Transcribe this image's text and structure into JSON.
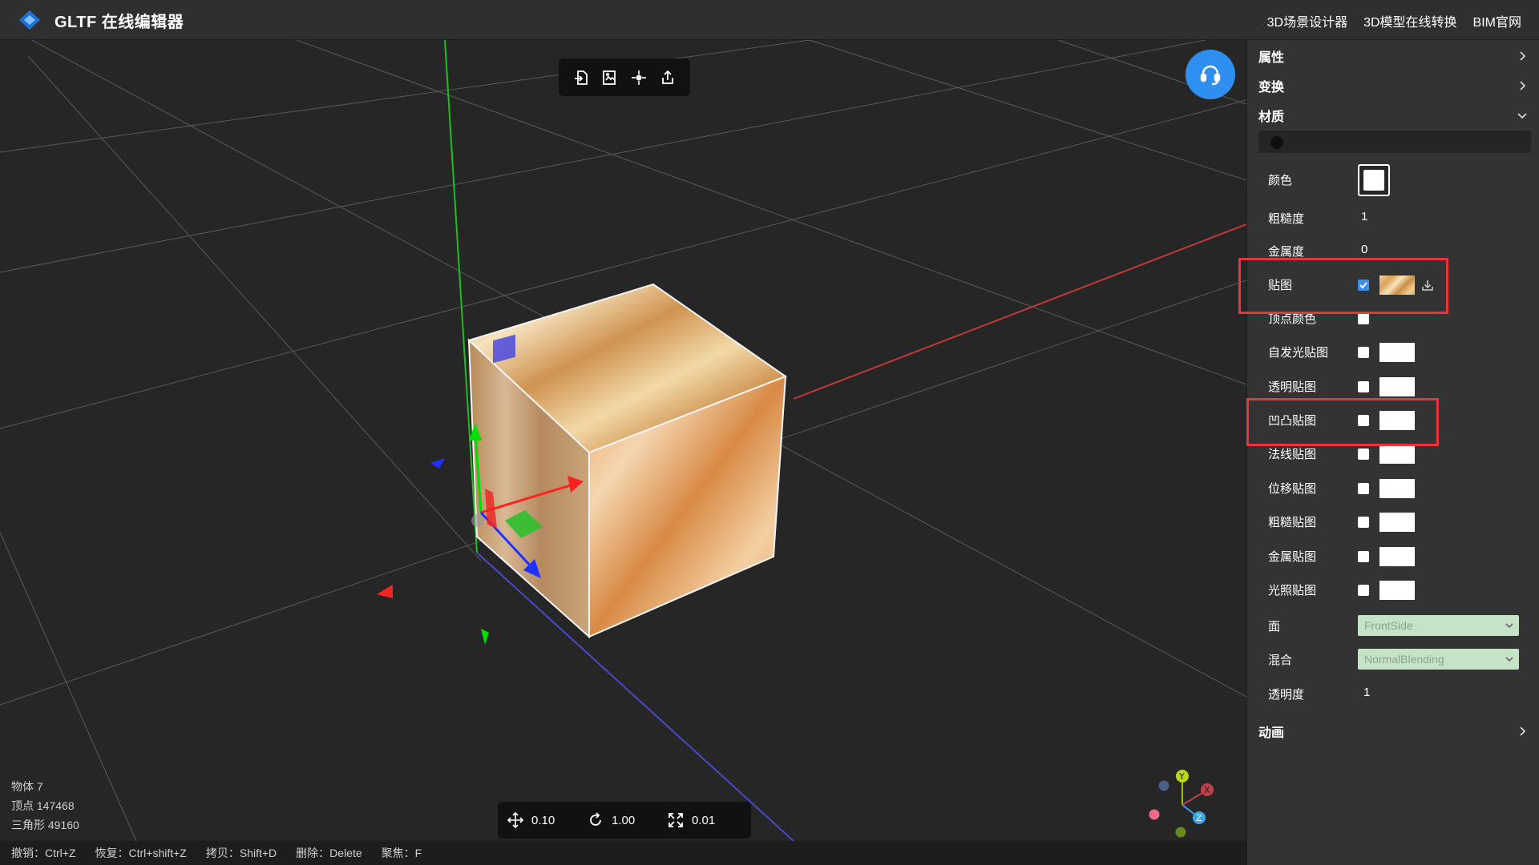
{
  "app": {
    "title": "GLTF 在线编辑器",
    "links": [
      "3D场景设计器",
      "3D模型在线转换",
      "BIM官网"
    ]
  },
  "toolbar": {
    "icons": [
      "import-icon",
      "export-image-icon",
      "focus-icon",
      "share-icon"
    ]
  },
  "stats": {
    "objects": "物体 7",
    "vertices": "顶点 147468",
    "triangles": "三角形 49160"
  },
  "snap": {
    "translate": "0.10",
    "rotate": "1.00",
    "scale": "0.01"
  },
  "gizmo": {
    "x": "X",
    "y": "Y",
    "z": "Z"
  },
  "statusbar": {
    "undo": "撤销：Ctrl+Z",
    "redo": "恢复：Ctrl+shift+Z",
    "copy": "拷贝：Shift+D",
    "delete": "删除：Delete",
    "focus": "聚焦：F"
  },
  "panel": {
    "sections": {
      "properties": "属性",
      "transform": "变换",
      "material": "材质",
      "animation": "动画"
    },
    "material": {
      "color_label": "颜色",
      "roughness_label": "粗糙度",
      "roughness": "1",
      "metalness_label": "金属度",
      "metalness": "0",
      "map_label": "贴图",
      "vertex_colors_label": "顶点颜色",
      "emissive_map_label": "自发光贴图",
      "alpha_map_label": "透明贴图",
      "bump_map_label": "凹凸贴图",
      "normal_map_label": "法线贴图",
      "displacement_map_label": "位移贴图",
      "roughness_map_label": "粗糙贴图",
      "metalness_map_label": "金属贴图",
      "light_map_label": "光照贴图",
      "side_label": "面",
      "side": "FrontSide",
      "blending_label": "混合",
      "blending": "NormalBlending",
      "opacity_label": "透明度",
      "opacity": "1",
      "map_enabled": true
    }
  },
  "colors": {
    "accent": "#2e8ff0",
    "highlight": "#f0323c",
    "panel": "#333333",
    "viewport": "#262626"
  }
}
